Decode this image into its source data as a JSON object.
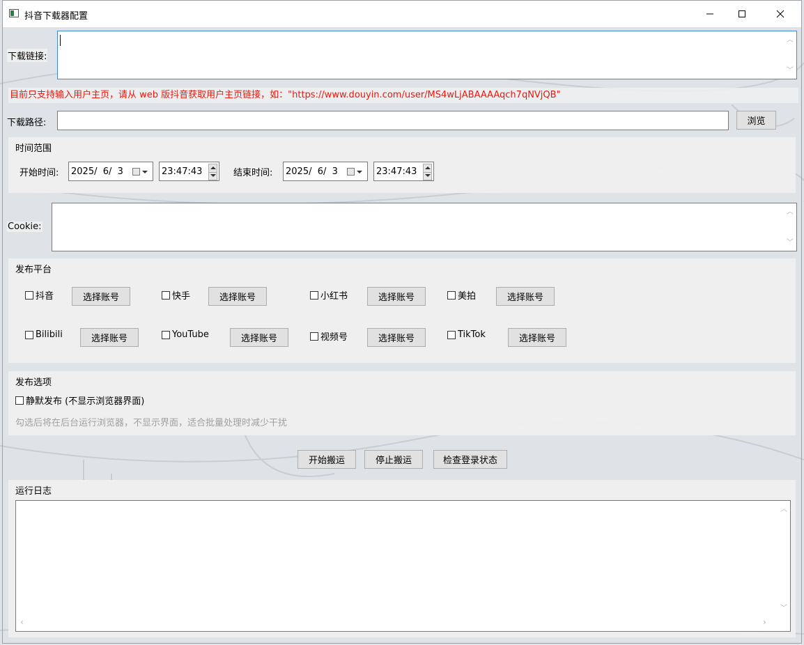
{
  "window": {
    "title": "抖音下载器配置",
    "minimize": "—",
    "maximize": "☐",
    "close": "✕"
  },
  "download_link": {
    "label": "下载链接:",
    "value": ""
  },
  "note": "目前只支持输入用户主页，请从 web 版抖音获取用户主页链接，如：\"https://www.douyin.com/user/MS4wLjABAAAAqch7qNVjQB\"",
  "download_path": {
    "label": "下载路径:",
    "value": "",
    "browse_button": "浏览"
  },
  "time_range": {
    "title": "时间范围",
    "start_label": "开始时间:",
    "start_date": "2025/  6/  3",
    "start_time": "23:47:43",
    "end_label": "结束时间:",
    "end_date": "2025/  6/  3",
    "end_time": "23:47:43"
  },
  "cookie": {
    "label": "Cookie:",
    "value": ""
  },
  "platforms": {
    "title": "发布平台",
    "select_account_label": "选择账号",
    "items": [
      {
        "name": "抖音",
        "checked": false
      },
      {
        "name": "快手",
        "checked": false
      },
      {
        "name": "小红书",
        "checked": false
      },
      {
        "name": "美拍",
        "checked": false
      },
      {
        "name": "Bilibili",
        "checked": false
      },
      {
        "name": "YouTube",
        "checked": false
      },
      {
        "name": "视频号",
        "checked": false
      },
      {
        "name": "TikTok",
        "checked": false
      }
    ]
  },
  "publish_options": {
    "title": "发布选项",
    "silent_label": "静默发布 (不显示浏览器界面)",
    "silent_checked": false,
    "hint": "勾选后将在后台运行浏览器，不显示界面，适合批量处理时减少干扰"
  },
  "actions": {
    "start": "开始搬运",
    "stop": "停止搬运",
    "check_login": "检查登录状态"
  },
  "log": {
    "title": "运行日志",
    "content": ""
  },
  "colors": {
    "note_red": "#e8190f",
    "focus_blue": "#3c8ad9",
    "hint_gray": "#a0a0a0"
  }
}
